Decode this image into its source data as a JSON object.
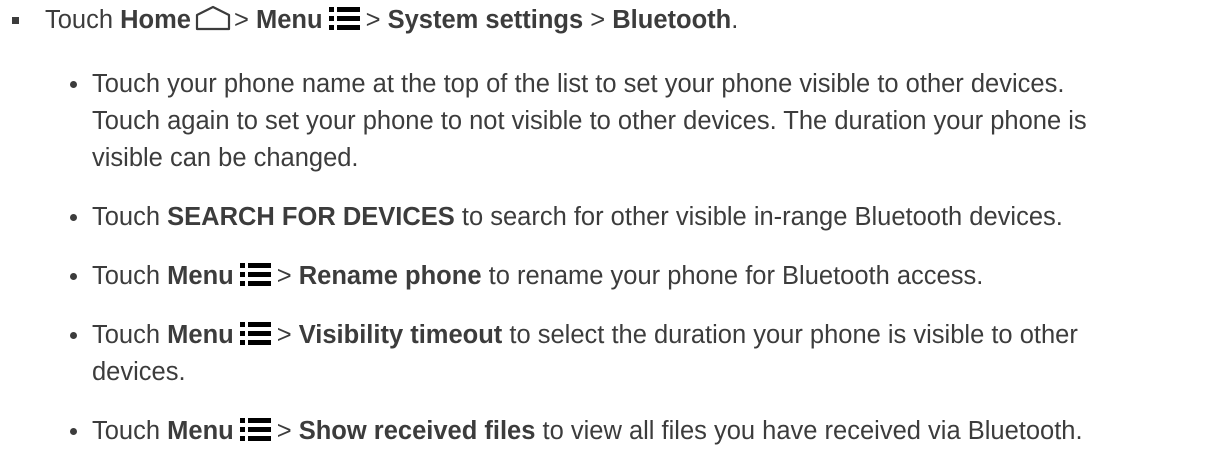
{
  "main_step": {
    "prefix": "Touch",
    "home": "Home",
    "sep1": ">",
    "menu": "Menu",
    "sep2": ">",
    "system_settings": "System settings",
    "sep3": ">",
    "bluetooth": "Bluetooth",
    "end": "."
  },
  "sub_steps": {
    "item1": {
      "line1": "Touch your phone name at the top of the list to set your phone visible to other devices.",
      "line2": "Touch again to set your phone to not visible to other devices. The duration your phone is",
      "line3": "visible can be changed."
    },
    "item2": {
      "prefix": "Touch",
      "bold": "SEARCH FOR DEVICES",
      "suffix": "to search for other visible in-range Bluetooth devices."
    },
    "item3": {
      "prefix": "Touch",
      "menu": "Menu",
      "sep": ">",
      "bold": "Rename phone",
      "suffix": "to rename your phone for Bluetooth access."
    },
    "item4": {
      "prefix": "Touch",
      "menu": "Menu",
      "sep": ">",
      "bold": "Visibility timeout",
      "suffix": "to select the duration your phone is visible to other",
      "line2": "devices."
    },
    "item5": {
      "prefix": "Touch",
      "menu": "Menu",
      "sep": ">",
      "bold": "Show received files",
      "suffix": "to view all files you have received via Bluetooth."
    }
  },
  "icons": {
    "home": "home-icon",
    "menu": "menu-icon"
  },
  "colors": {
    "text": "#3c3c3c"
  }
}
